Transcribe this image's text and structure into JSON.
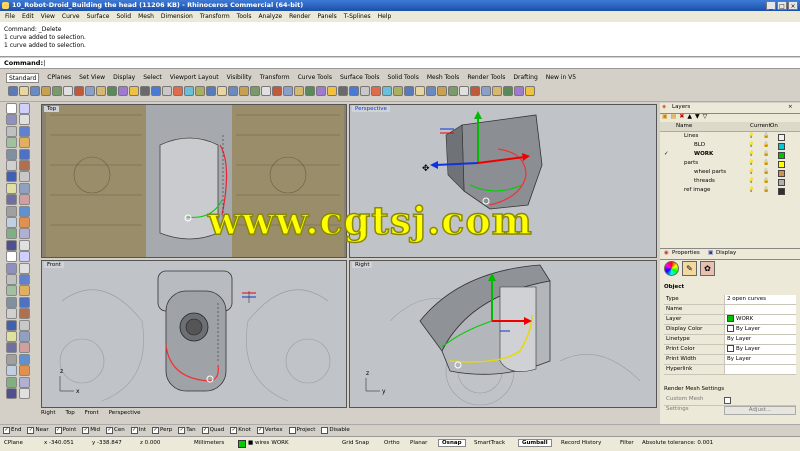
{
  "window": {
    "title": "10_Robot-Droid_Building the head (11206 KB) - Rhinoceros Commercial (64-bit)"
  },
  "menu": [
    "File",
    "Edit",
    "View",
    "Curve",
    "Surface",
    "Solid",
    "Mesh",
    "Dimension",
    "Transform",
    "Tools",
    "Analyze",
    "Render",
    "Panels",
    "T-Splines",
    "Help"
  ],
  "command_history": [
    "Command: _Delete",
    "1 curve added to selection.",
    "1 curve added to selection."
  ],
  "command_prompt": "Command:",
  "toolbar_tabs": [
    "Standard",
    "CPlanes",
    "Set View",
    "Display",
    "Select",
    "Viewport Layout",
    "Visibility",
    "Transform",
    "Curve Tools",
    "Surface Tools",
    "Solid Tools",
    "Mesh Tools",
    "Render Tools",
    "Drafting",
    "New in V5"
  ],
  "toolbar_active_tab": "Standard",
  "viewports": {
    "top": "Top",
    "perspective": "Perspective",
    "front": "Front",
    "right": "Right"
  },
  "viewport_tabs": [
    "Right",
    "Top",
    "Front",
    "Perspective"
  ],
  "watermark": "www.cgtsj.com",
  "layers": {
    "panel_title": "Layers",
    "col_name": "Name",
    "col_on": "On",
    "rows": [
      {
        "name": "Lines",
        "indent": 1,
        "color": "#f0f0f0"
      },
      {
        "name": "BLD",
        "indent": 2,
        "color": "#00c8d0"
      },
      {
        "name": "WORK",
        "indent": 2,
        "color": "#00c000",
        "current": true
      },
      {
        "name": "parts",
        "indent": 1,
        "color": "#ffff00"
      },
      {
        "name": "wheel parts",
        "indent": 2,
        "color": "#d09050"
      },
      {
        "name": "threads",
        "indent": 2,
        "color": "#b0b0b0"
      },
      {
        "name": "ref image",
        "indent": 1,
        "color": "#303030"
      }
    ]
  },
  "properties": {
    "tab_properties": "Properties",
    "tab_display": "Display",
    "section_object": "Object",
    "rows": [
      {
        "key": "Type",
        "value": "2 open curves"
      },
      {
        "key": "Name",
        "value": ""
      },
      {
        "key": "Layer",
        "value": "WORK",
        "swatch": "#00c000"
      },
      {
        "key": "Display Color",
        "value": "By Layer",
        "swatch": "#ffffff"
      },
      {
        "key": "Linetype",
        "value": "By Layer"
      },
      {
        "key": "Print Color",
        "value": "By Layer",
        "swatch": "#ffffff"
      },
      {
        "key": "Print Width",
        "value": "By Layer"
      },
      {
        "key": "Hyperlink",
        "value": ""
      }
    ],
    "render_mesh_title": "Render Mesh Settings",
    "custom_mesh": "Custom Mesh",
    "settings_label": "Settings",
    "adjust_button": "Adjust..."
  },
  "osnaps": [
    {
      "label": "End",
      "checked": true
    },
    {
      "label": "Near",
      "checked": true
    },
    {
      "label": "Point",
      "checked": true
    },
    {
      "label": "Mid",
      "checked": true
    },
    {
      "label": "Cen",
      "checked": true
    },
    {
      "label": "Int",
      "checked": true
    },
    {
      "label": "Perp",
      "checked": true
    },
    {
      "label": "Tan",
      "checked": true
    },
    {
      "label": "Quad",
      "checked": true
    },
    {
      "label": "Knot",
      "checked": true
    },
    {
      "label": "Vertex",
      "checked": true
    },
    {
      "label": "Project",
      "checked": false
    },
    {
      "label": "Disable",
      "checked": false
    }
  ],
  "status": {
    "cplane": "CPlane",
    "x": "x -340.051",
    "y": "y -338.847",
    "z": "z 0.000",
    "units": "Millimeters",
    "layer_prefix": "■ wires",
    "layer": "WORK",
    "grid_snap": "Grid Snap",
    "ortho": "Ortho",
    "planar": "Planar",
    "osnap": "Osnap",
    "smarttrack": "SmartTrack",
    "gumball": "Gumball",
    "record_history": "Record History",
    "filter": "Filter",
    "tolerance": "Absolute tolerance: 0.001"
  }
}
